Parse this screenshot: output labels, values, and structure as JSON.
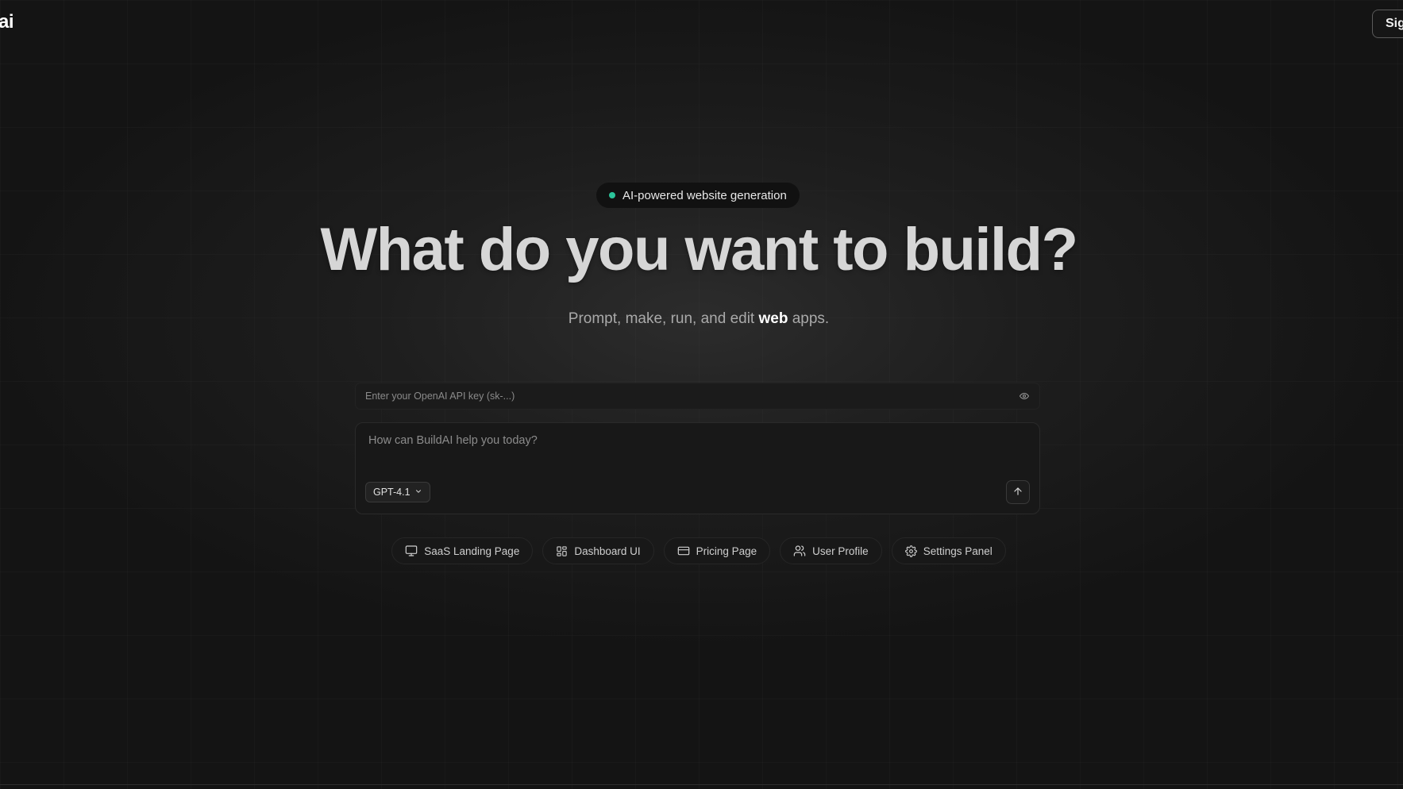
{
  "header": {
    "logo_text": "ai",
    "signin_label": "Sig"
  },
  "hero": {
    "badge_text": "AI-powered website generation",
    "badge_dot_color": "#2bc49a",
    "headline": "What do you want to build?",
    "subline_before": "Prompt, make, run, and edit ",
    "subline_bold": "web",
    "subline_after": " apps."
  },
  "api_key": {
    "placeholder": "Enter your OpenAI API key (sk-...)",
    "value": "",
    "icon": "eye-icon"
  },
  "prompt": {
    "placeholder": "How can BuildAI help you today?",
    "value": "",
    "model_label": "GPT-4.1",
    "send_icon": "arrow-up-icon"
  },
  "suggestions": [
    {
      "label": "SaaS Landing Page",
      "icon": "monitor-icon"
    },
    {
      "label": "Dashboard UI",
      "icon": "grid-icon"
    },
    {
      "label": "Pricing Page",
      "icon": "credit-card-icon"
    },
    {
      "label": "User Profile",
      "icon": "users-icon"
    },
    {
      "label": "Settings Panel",
      "icon": "gear-icon"
    }
  ]
}
